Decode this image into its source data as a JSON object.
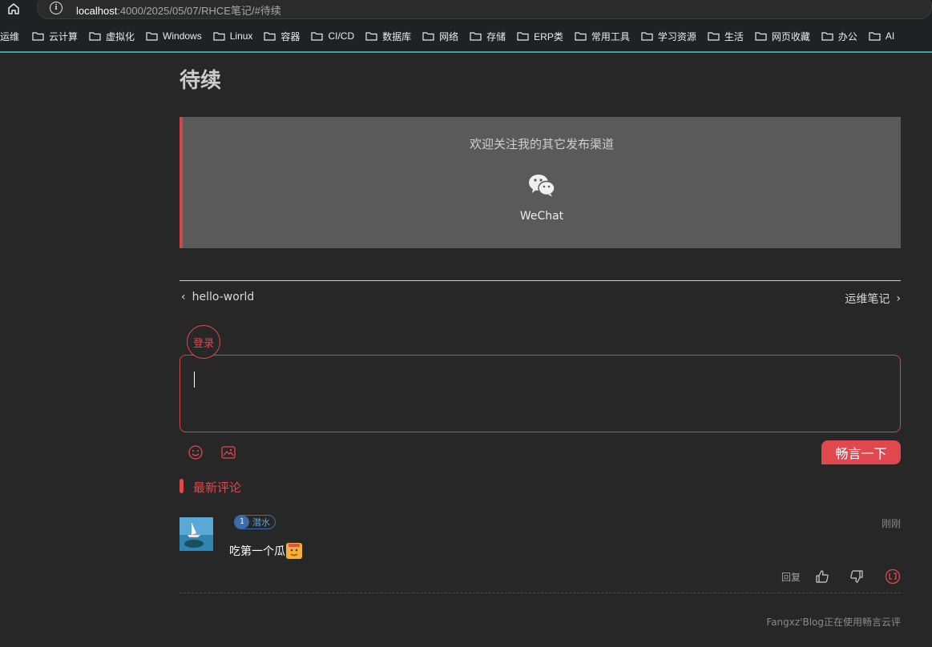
{
  "browser": {
    "url_host": "localhost",
    "url_path": ":4000/2025/05/07/RHCE笔记/#待续",
    "bookmarks": [
      "运维",
      "云计算",
      "虚拟化",
      "Windows",
      "Linux",
      "容器",
      "CI/CD",
      "数据库",
      "网络",
      "存储",
      "ERP类",
      "常用工具",
      "学习资源",
      "生活",
      "网页收藏",
      "办公",
      "AI"
    ]
  },
  "article": {
    "heading": "待续"
  },
  "channels": {
    "title": "欢迎关注我的其它发布渠道",
    "wechat_label": "WeChat"
  },
  "nav": {
    "prev": "hello-world",
    "next": "运维笔记"
  },
  "comment_form": {
    "login_label": "登录",
    "submit_label": "畅言一下"
  },
  "latest": {
    "title": "最新评论",
    "comments": [
      {
        "level": "1",
        "badge": "潜水",
        "time": "刚刚",
        "text": "吃第一个瓜",
        "reply_label": "回复"
      }
    ]
  },
  "footer": {
    "text": "Fangxz'Blog正在使用畅言云评"
  },
  "colors": {
    "accent": "#e0484e",
    "background": "#272727",
    "panel": "#5a5a5a",
    "teal": "#3aa59a",
    "badge_blue": "#3b6ea8"
  }
}
